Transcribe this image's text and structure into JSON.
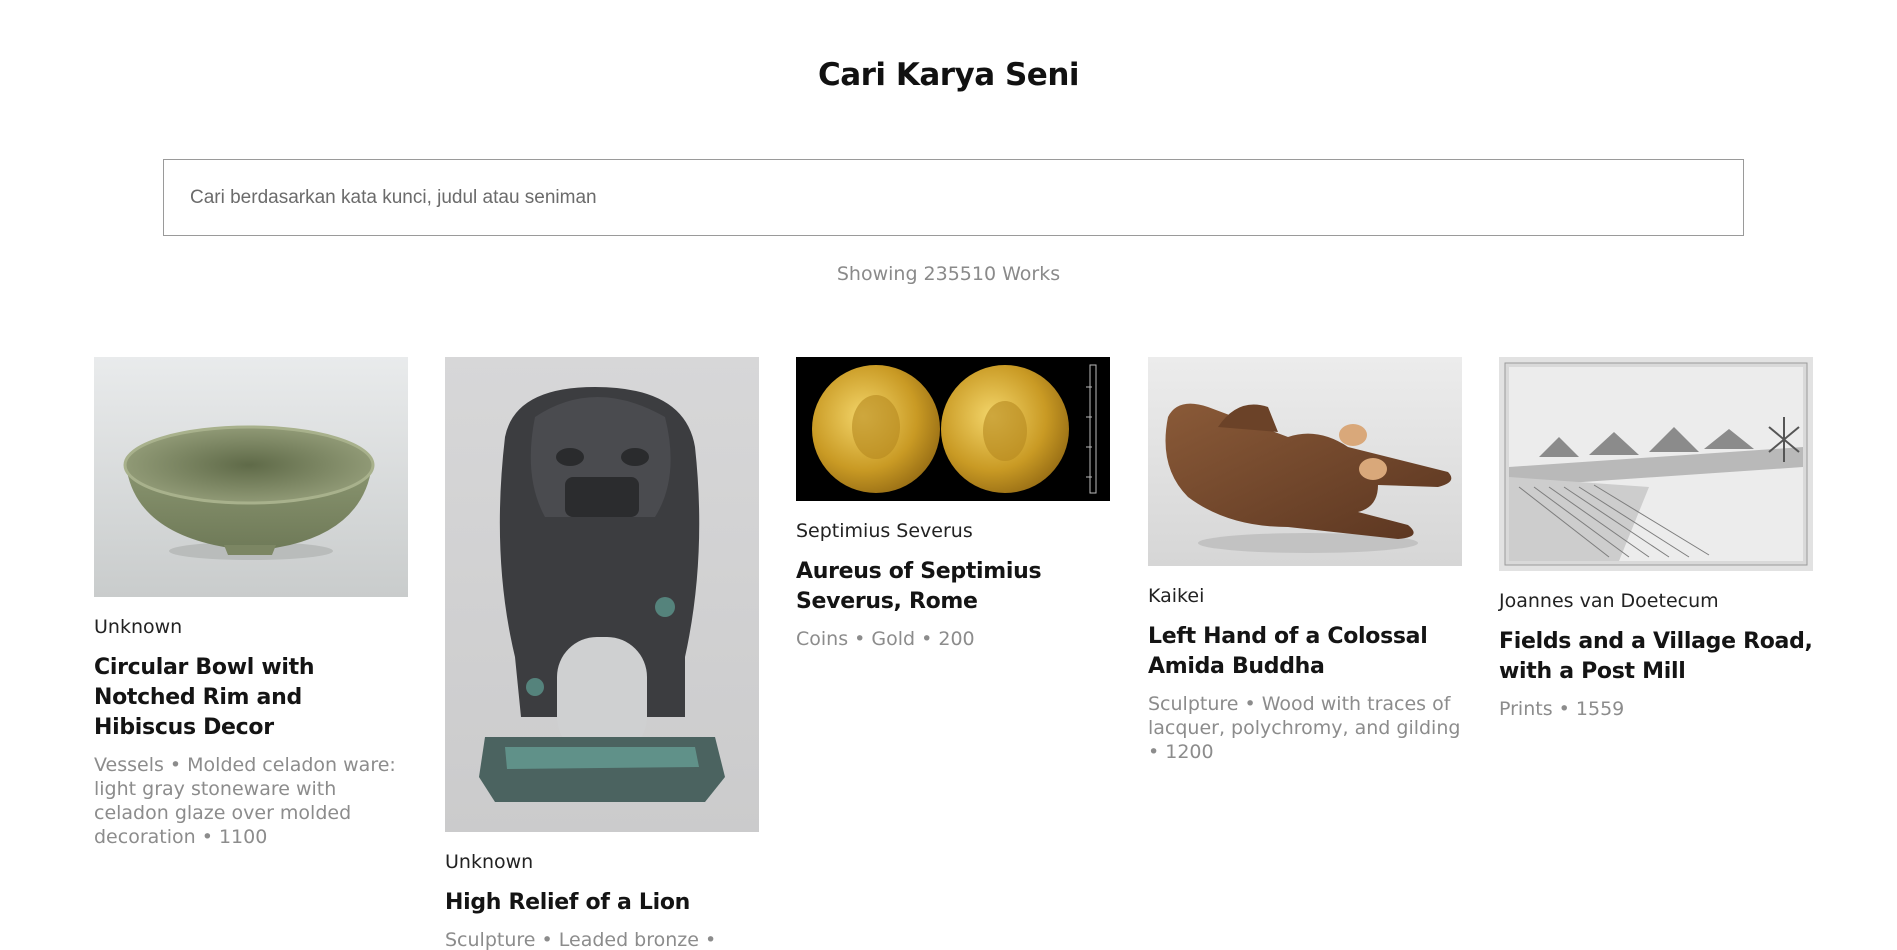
{
  "header": {
    "title": "Cari Karya Seni"
  },
  "search": {
    "placeholder": "Cari berdasarkan kata kunci, judul atau seniman",
    "value": ""
  },
  "results": {
    "count_text": "Showing 235510 Works"
  },
  "artworks": [
    {
      "artist": "Unknown",
      "title": "Circular Bowl with Notched Rim and Hibiscus Decor",
      "meta": "Vessels • Molded celadon ware: light gray stoneware with celadon glaze over molded decoration • 1100",
      "image": "celadon-bowl-image"
    },
    {
      "artist": "Unknown",
      "title": "High Relief of a Lion",
      "meta": "Sculpture • Leaded bronze •",
      "image": "bronze-lion-image"
    },
    {
      "artist": "Septimius Severus",
      "title": "Aureus of Septimius Severus, Rome",
      "meta": "Coins • Gold • 200",
      "image": "gold-coins-image"
    },
    {
      "artist": "Kaikei",
      "title": "Left Hand of a Colossal Amida Buddha",
      "meta": "Sculpture • Wood with traces of lacquer, polychromy, and gilding • 1200",
      "image": "wooden-hand-image"
    },
    {
      "artist": "Joannes van Doetecum",
      "title": "Fields and a Village Road, with a Post Mill",
      "meta": "Prints • 1559",
      "image": "village-print-image"
    }
  ]
}
